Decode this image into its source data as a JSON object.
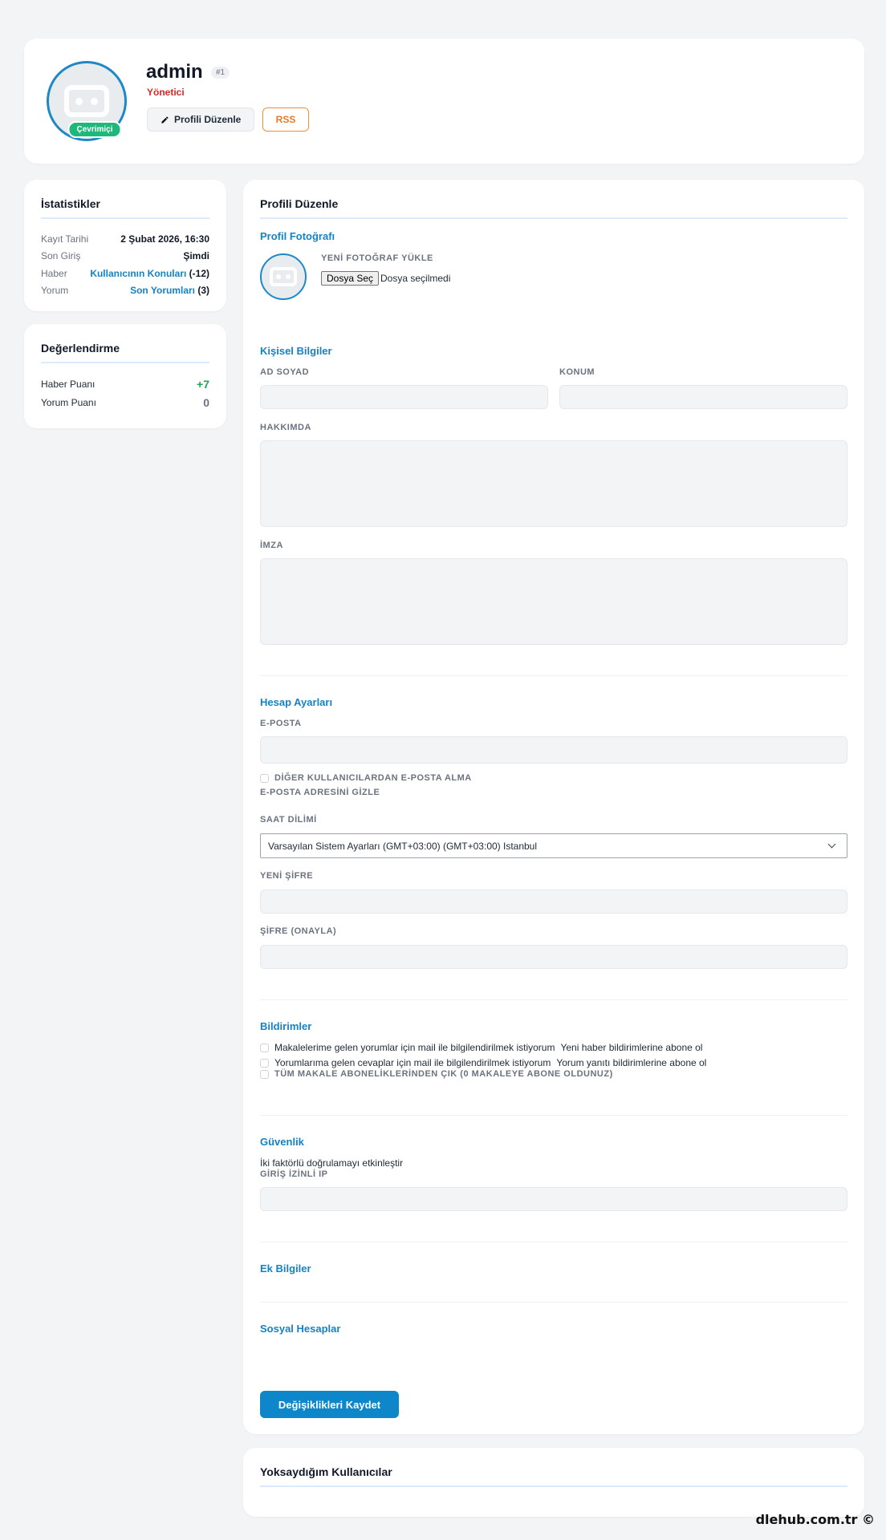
{
  "profile": {
    "username": "admin",
    "user_id": "#1",
    "role": "Yönetici",
    "online_label": "Çevrimiçi",
    "edit_button": "Profili Düzenle",
    "rss_button": "RSS"
  },
  "stats": {
    "title": "İstatistikler",
    "rows": [
      {
        "label": "Kayıt Tarihi",
        "value": "2 Şubat 2026, 16:30"
      },
      {
        "label": "Son Giriş",
        "value": "Şimdi"
      },
      {
        "label": "Haber",
        "link": "Kullanıcının Konuları",
        "suffix": " (-12)"
      },
      {
        "label": "Yorum",
        "link": "Son Yorumları",
        "suffix": " (3)"
      }
    ]
  },
  "rating": {
    "title": "Değerlendirme",
    "news_label": "Haber Puanı",
    "news_value": "+7",
    "comment_label": "Yorum Puanı",
    "comment_value": "0"
  },
  "form": {
    "title": "Profili Düzenle",
    "photo_section": "Profil Fotoğrafı",
    "upload_label": "YENİ FOTOĞRAF YÜKLE",
    "file_button": "Dosya Seç",
    "file_none": "Dosya seçilmedi",
    "personal_section": "Kişisel Bilgiler",
    "fullname_label": "AD SOYAD",
    "location_label": "KONUM",
    "about_label": "HAKKIMDA",
    "signature_label": "İMZA",
    "account_section": "Hesap Ayarları",
    "email_label": "E-POSTA",
    "no_email_label": "DİĞER KULLANICILARDAN E-POSTA ALMA",
    "hide_email_label": "E-POSTA ADRESİNİ GİZLE",
    "timezone_label": "SAAT DİLİMİ",
    "timezone_value": "Varsayılan Sistem Ayarları (GMT+03:00) (GMT+03:00) Istanbul",
    "new_password_label": "YENİ ŞİFRE",
    "confirm_password_label": "ŞİFRE (ONAYLA)",
    "notifications_section": "Bildirimler",
    "notify_comments": "Makalelerime gelen yorumlar için mail ile bilgilendirilmek istiyorum",
    "notify_news": "Yeni haber bildirimlerine abone ol",
    "notify_replies": "Yorumlarıma gelen cevaplar için mail ile bilgilendirilmek istiyorum",
    "notify_reply_sub": "Yorum yanıtı bildirimlerine abone ol",
    "unsubscribe_all": "TÜM MAKALE ABONELİKLERİNDEN ÇIK (0 MAKALEYE ABONE OLDUNUZ)",
    "security_section": "Güvenlik",
    "two_factor": "İki faktörlü doğrulamayı etkinleştir",
    "allowed_ip_label": "GİRİŞ İZİNLİ IP",
    "extra_section": "Ek Bilgiler",
    "social_section": "Sosyal Hesaplar",
    "save_button": "Değişiklikleri Kaydet"
  },
  "ignored": {
    "title": "Yoksaydığım Kullanıcılar"
  },
  "watermark": "dlehub.com.tr ©",
  "colors": {
    "accent": "#1582c4",
    "role_red": "#dc2626",
    "online_green": "#1db97a",
    "rss_orange": "#ea7a24",
    "save_blue": "#0d87c9",
    "rating_green": "#22a356"
  }
}
